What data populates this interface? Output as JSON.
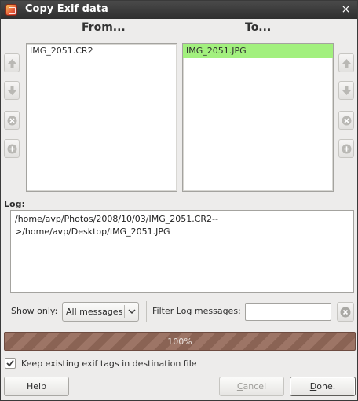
{
  "window": {
    "title": "Copy Exif data",
    "close_glyph": "×"
  },
  "from": {
    "header": "From...",
    "items": [
      "IMG_2051.CR2"
    ]
  },
  "to": {
    "header": "To...",
    "items": [
      "IMG_2051.JPG"
    ],
    "selected_index": 0
  },
  "side_buttons": {
    "icons": [
      "arrow-up-icon",
      "arrow-down-icon",
      "remove-icon",
      "add-icon"
    ]
  },
  "log": {
    "label": "Log:",
    "lines": [
      "/home/avp/Photos/2008/10/03/IMG_2051.CR2--",
      ">/home/avp/Desktop/IMG_2051.JPG"
    ]
  },
  "filter": {
    "show_only_mnemonic": "S",
    "show_only_rest": "how only:",
    "combo_value": "All messages",
    "filter_mnemonic": "F",
    "filter_rest": "ilter Log messages:",
    "filter_value": ""
  },
  "progress": {
    "text": "100%",
    "fraction": 1.0
  },
  "keep_exif": {
    "label": "Keep existing exif tags in destination file",
    "checked": true
  },
  "buttons": {
    "help": "Help",
    "cancel_mnemonic": "C",
    "cancel_rest": "ancel",
    "done_mnemonic": "D",
    "done_rest": "one."
  },
  "colors": {
    "selected_row": "#a2f07e",
    "titlebar": "#3a3a3a",
    "progress": "#8f6a5c"
  }
}
